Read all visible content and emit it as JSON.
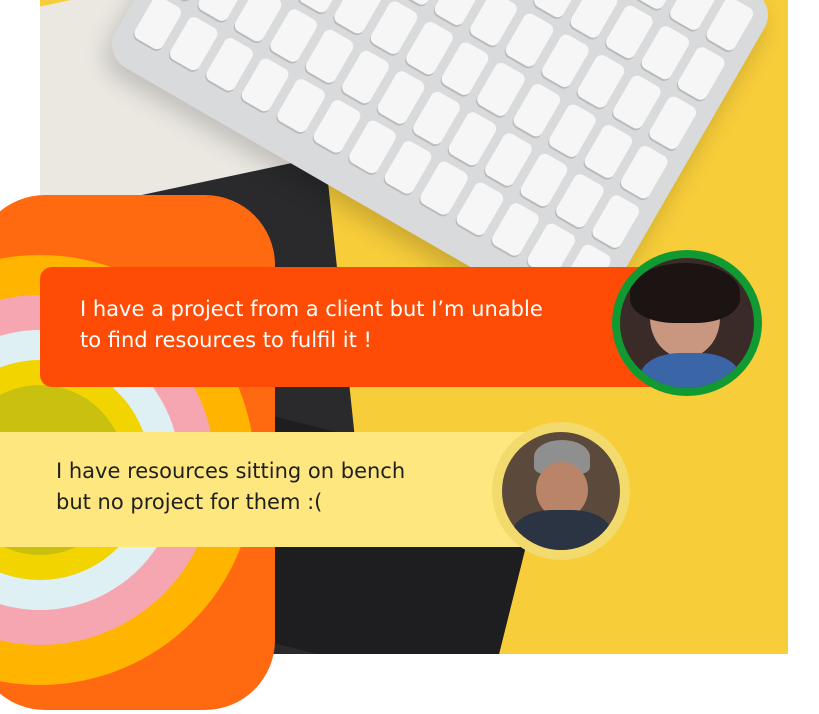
{
  "messages": [
    {
      "lines": [
        "I have a project from a client but I’m unable",
        "to find resources to fulfil it !"
      ],
      "bubble_color": "#fe4b06",
      "text_color": "#ffffff",
      "avatar_ring_color": "#129a32"
    },
    {
      "lines": [
        "I have resources sitting on bench",
        "but no project for them :("
      ],
      "bubble_color": "#fde77e",
      "text_color": "#1f1f1f",
      "avatar_ring_color": "#f3da6c"
    }
  ],
  "colors": {
    "background_yellow": "#f7cd3a",
    "card_orange": "#ff6a10"
  }
}
